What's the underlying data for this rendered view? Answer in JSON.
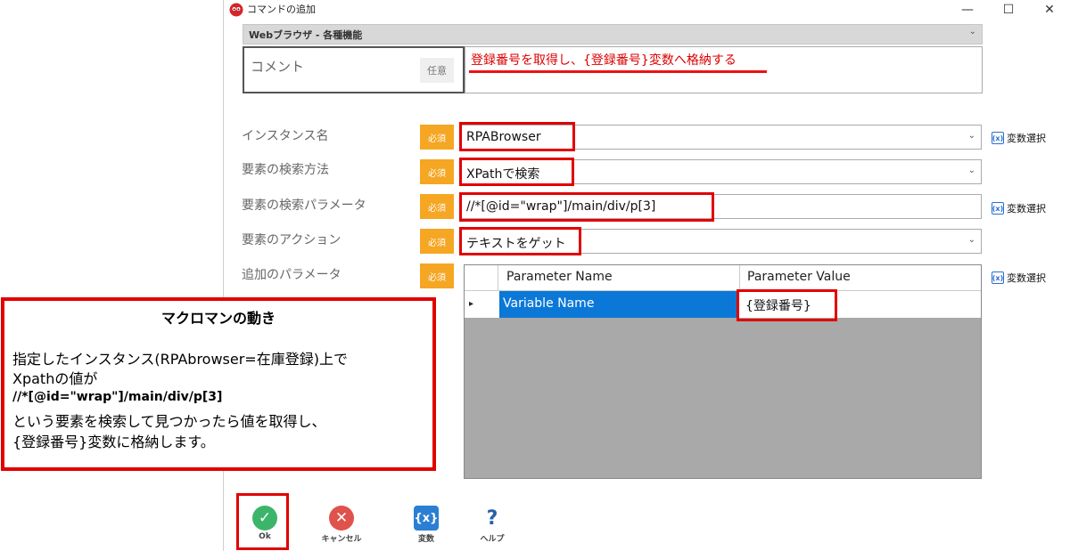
{
  "window": {
    "title": "コマンドの追加",
    "min": "—",
    "max": "☐",
    "close": "✕"
  },
  "category": {
    "label": "Webブラウザ - 各種機能",
    "chevron": "⌄"
  },
  "comment": {
    "label": "コメント",
    "badge": "任意",
    "value": "登録番号を取得し、{登録番号}変数へ格納する"
  },
  "fields": [
    {
      "label": "インスタンス名",
      "badge": "必須",
      "value": "RPABrowser",
      "has_dropdown": true,
      "var_select": "変数選択"
    },
    {
      "label": "要素の検索方法",
      "badge": "必須",
      "value": "XPathで検索",
      "has_dropdown": true
    },
    {
      "label": "要素の検索パラメータ",
      "badge": "必須",
      "value": "//*[@id=\"wrap\"]/main/div/p[3]",
      "has_dropdown": false,
      "var_select": "変数選択"
    },
    {
      "label": "要素のアクション",
      "badge": "必須",
      "value": "テキストをゲット",
      "has_dropdown": true
    },
    {
      "label": "追加のパラメータ",
      "badge": "必須",
      "var_select": "変数選択"
    }
  ],
  "var_icon": "(x)",
  "param_table": {
    "headers": [
      "Parameter Name",
      "Parameter Value"
    ],
    "rows": [
      {
        "name": "Variable Name",
        "value": "{登録番号}"
      }
    ],
    "row_marker": "▸"
  },
  "note": {
    "title": "マクロマンの動き",
    "line1": "指定したインスタンス(RPAbrowser=在庫登録)上で",
    "line2": "Xpathの値が",
    "line3": "//*[@id=\"wrap\"]/main/div/p[3]",
    "line4": "という要素を検索して見つかったら値を取得し、",
    "line5": "{登録番号}変数に格納します。"
  },
  "buttons": {
    "ok": "Ok",
    "cancel": "キャンセル",
    "variable": "変数",
    "help": "ヘルプ",
    "variable_icon_text": "{x}",
    "help_icon_text": "?"
  },
  "colors": {
    "required_badge": "#f5a623",
    "highlight_red": "#e10000",
    "selected_row": "#0b78d7",
    "ok_green": "#3cb56a",
    "cancel_red": "#e0524c",
    "variable_blue": "#2a7fd4",
    "help_blue": "#2a5fa8"
  }
}
